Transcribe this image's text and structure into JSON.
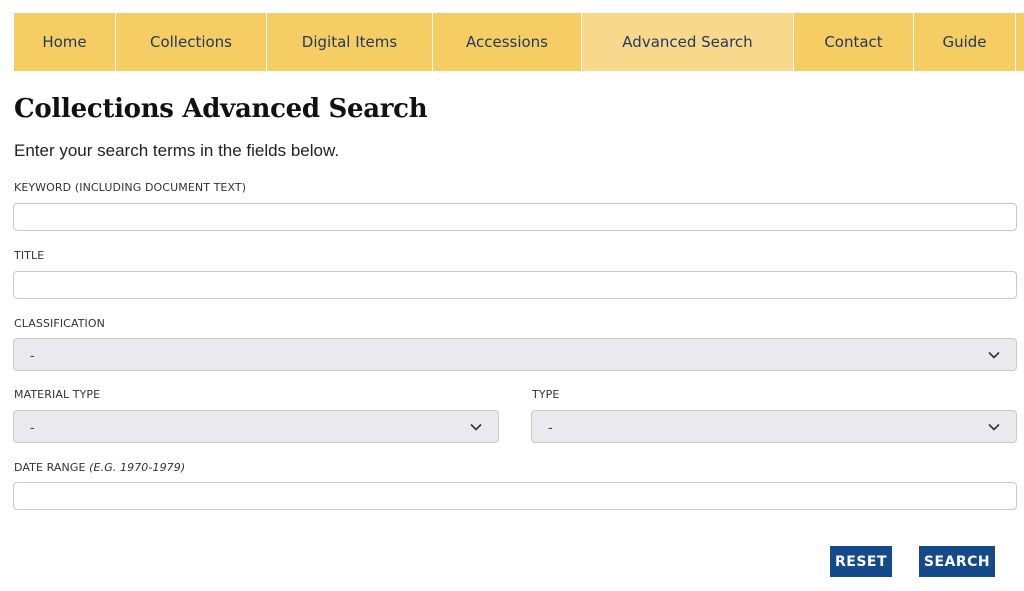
{
  "nav": {
    "items": [
      {
        "label": "Home"
      },
      {
        "label": "Collections"
      },
      {
        "label": "Digital Items"
      },
      {
        "label": "Accessions"
      },
      {
        "label": "Advanced Search",
        "active": true
      },
      {
        "label": "Contact"
      },
      {
        "label": "Guide"
      }
    ]
  },
  "page": {
    "title": "Collections Advanced Search",
    "intro": "Enter your search terms in the fields below."
  },
  "form": {
    "keyword": {
      "label": "KEYWORD (INCLUDING DOCUMENT TEXT)",
      "value": ""
    },
    "title": {
      "label": "TITLE",
      "value": ""
    },
    "classification": {
      "label": "CLASSIFICATION",
      "selected": "-"
    },
    "material_type": {
      "label": "MATERIAL TYPE",
      "selected": "-"
    },
    "type": {
      "label": "TYPE",
      "selected": "-"
    },
    "date_range": {
      "label": "DATE RANGE",
      "hint": "(E.G. 1970-1979)",
      "value": ""
    }
  },
  "buttons": {
    "reset_label": "RESET",
    "search_label": "SEARCH"
  },
  "colors": {
    "nav_background": "#f5cd63",
    "nav_active": "#f8d98c",
    "nav_text": "#1f3a5f",
    "button_background": "#154a8a",
    "select_background": "#e9e9ee"
  }
}
